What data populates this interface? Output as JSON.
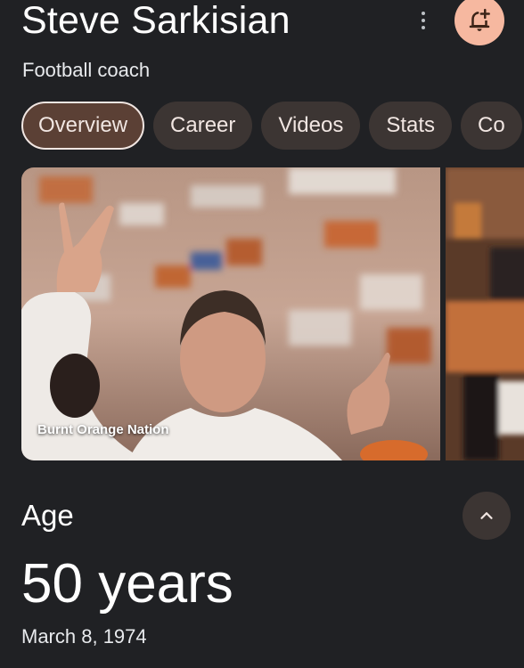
{
  "header": {
    "title": "Steve Sarkisian",
    "subtitle": "Football coach",
    "more_icon": "more-vert-icon",
    "alert_icon": "add-alert-bell-icon",
    "alert_bg": "#f6b8a0"
  },
  "tabs": [
    {
      "label": "Overview",
      "active": true
    },
    {
      "label": "Career"
    },
    {
      "label": "Videos"
    },
    {
      "label": "Stats"
    },
    {
      "label": "Co"
    }
  ],
  "carousel": {
    "credit": "Burnt Orange Nation"
  },
  "age": {
    "label": "Age",
    "value": "50 years",
    "birth_date": "March 8, 1974",
    "collapse_icon": "chevron-up-icon"
  }
}
